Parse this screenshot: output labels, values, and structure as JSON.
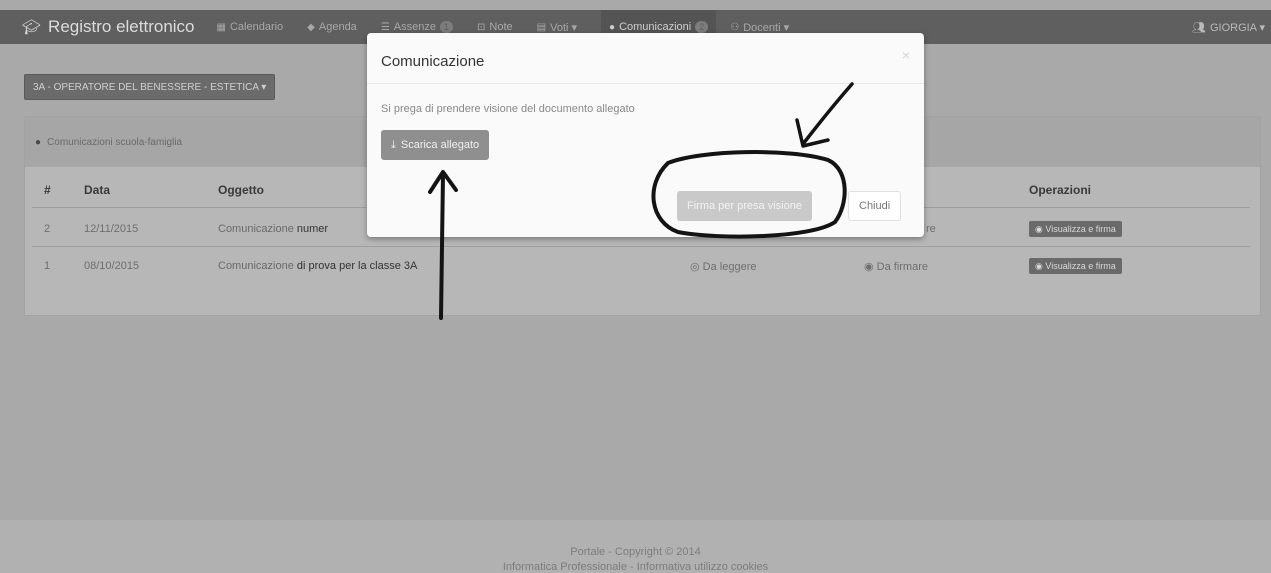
{
  "navbar": {
    "brand": "Registro elettronico",
    "items": [
      {
        "icon": "calendar-icon",
        "glyph": "▦",
        "label": "Calendario",
        "badge": ""
      },
      {
        "icon": "tag-icon",
        "glyph": "◆",
        "label": "Agenda",
        "badge": ""
      },
      {
        "icon": "list-icon",
        "glyph": "☰",
        "label": "Assenze",
        "badge": "1"
      },
      {
        "icon": "clip-icon",
        "glyph": "⊡",
        "label": "Note",
        "badge": ""
      },
      {
        "icon": "grades-icon",
        "glyph": "▤",
        "label": "Voti ▾",
        "badge": ""
      }
    ],
    "active_item": {
      "icon": "comment-icon",
      "label": "Comunicazioni",
      "badge": "2"
    },
    "docenti": "Docenti ▾",
    "user": "GIORGIA ▾"
  },
  "class_selector": "3A - OPERATORE DEL BENESSERE - ESTETICA ▾",
  "panel": {
    "heading": "Comunicazioni scuola-famiglia",
    "headers": {
      "num": "#",
      "date": "Data",
      "subject": "Oggetto",
      "operations": "Operazioni"
    },
    "rows": [
      {
        "num": "2",
        "date": "12/11/2015",
        "subject_prefix": "Comunicazione",
        "subject_rest": "numer",
        "read": "",
        "sign": "re",
        "action": "Visualizza e firma"
      },
      {
        "num": "1",
        "date": "08/10/2015",
        "subject_prefix": "Comunicazione",
        "subject_rest": "di prova per la classe 3A",
        "read": "Da leggere",
        "sign": "Da firmare",
        "action": "Visualizza e firma"
      }
    ]
  },
  "modal": {
    "title": "Comunicazione",
    "close": "×",
    "body": "Si prega di prendere visione del documento allegato",
    "download_button": "Scarica allegato",
    "sign_button": "Firma per presa visione",
    "close_button": "Chiudi"
  },
  "footer": {
    "line1": "Portale - Copyright © 2014",
    "line2": "Informatica Professionale - Informativa utilizzo cookies"
  },
  "colors": {
    "navbar": "#5f5f5f",
    "overlay_bg": "#a9a9a9",
    "modal": "#fafafa",
    "ink": "#1a1a1a"
  }
}
